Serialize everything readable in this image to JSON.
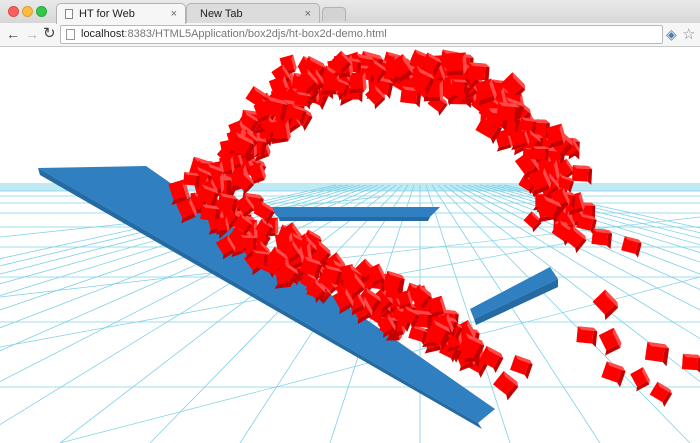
{
  "window": {
    "tabs": [
      {
        "title": "HT for Web",
        "active": true
      },
      {
        "title": "New Tab",
        "active": false
      }
    ],
    "close_glyph": "×"
  },
  "toolbar": {
    "back_icon": "←",
    "forward_icon": "→",
    "reload_icon": "↻",
    "url_host": "localhost",
    "url_rest": ":8383/HTML5Application/box2djs/ht-box2d-demo.html",
    "star_icon": "☆"
  },
  "scene": {
    "grid_color": "#7fd0e6",
    "horizon_color": "#bfe9f3",
    "plank_color": "#2f7fc1",
    "plank_side_color": "#246aa3",
    "box_color": "#ff0000",
    "box_shade": "#c40000",
    "box_light": "#ff4a4a"
  }
}
